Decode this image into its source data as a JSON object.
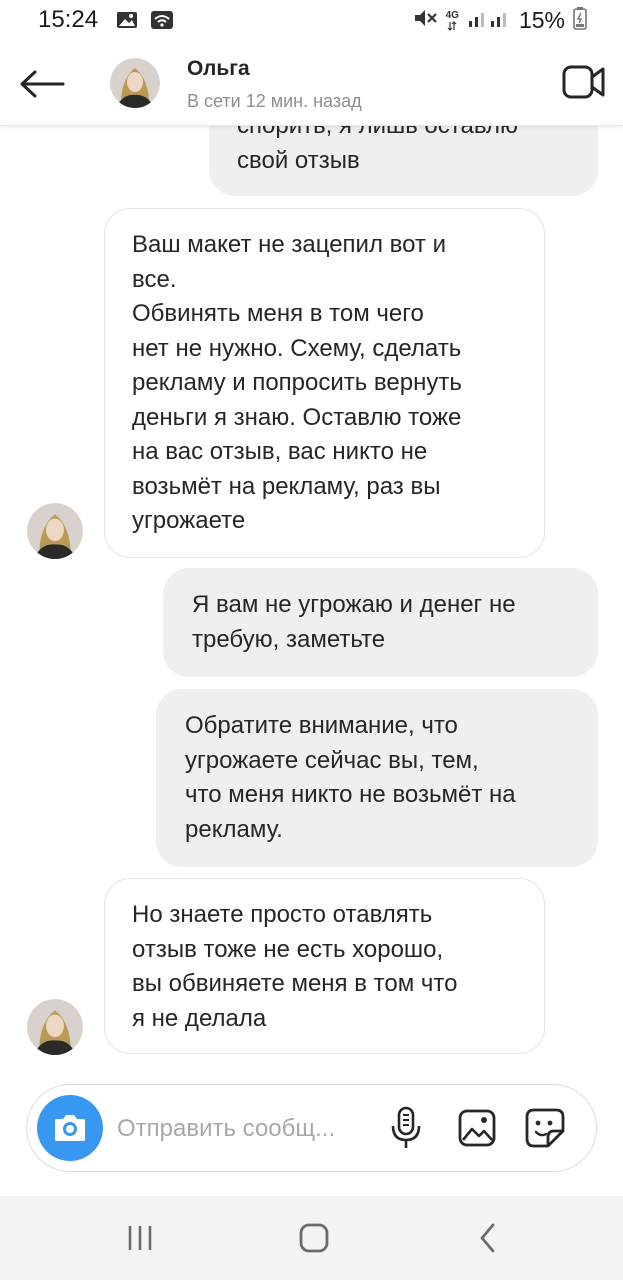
{
  "status_bar": {
    "time": "15:24",
    "network": "4G",
    "battery": "15%",
    "icons": [
      "gallery-icon",
      "wifi-icon",
      "mute-icon",
      "signal-icon",
      "battery-icon"
    ]
  },
  "header": {
    "contact_name": "Ольга",
    "contact_status": "В сети 12 мин. назад",
    "icons": [
      "back-arrow-icon",
      "video-call-icon"
    ]
  },
  "messages": [
    {
      "from": "me",
      "lines": [
        "спорить, я лишь оставлю",
        "свой отзыв"
      ]
    },
    {
      "from": "contact",
      "lines": [
        "Ваш макет не зацепил вот и",
        "все.",
        "Обвинять меня в том чего",
        "нет не нужно. Схему, сделать",
        "рекламу и попросить вернуть",
        "деньги я знаю. Оставлю тоже",
        "на вас отзыв, вас никто не",
        "возьмёт на рекламу, раз вы",
        "угрожаете"
      ]
    },
    {
      "from": "me",
      "lines": [
        "Я вам не угрожаю и денег не",
        "требую, заметьте"
      ]
    },
    {
      "from": "me",
      "lines": [
        "Обратите внимание, что",
        "угрожаете сейчас вы, тем,",
        "что меня никто не возьмёт на",
        "рекламу."
      ]
    },
    {
      "from": "contact",
      "lines": [
        "Но знаете просто отавлять",
        "отзыв тоже не есть хорошо,",
        "вы обвиняете меня в том что",
        "я не делала"
      ]
    }
  ],
  "composer": {
    "placeholder": "Отправить сообщ...",
    "icons": [
      "camera-icon",
      "microphone-icon",
      "gallery-icon",
      "sticker-icon"
    ]
  },
  "colors": {
    "accent": "#3897f0",
    "outgoing_bubble": "#efefef",
    "incoming_border": "#e3e3e3",
    "secondary_text": "#8e8e8e",
    "nav_bar": "#f3f3f3"
  },
  "nav_bar": {
    "icons": [
      "recent-apps-icon",
      "home-icon",
      "back-icon"
    ]
  }
}
